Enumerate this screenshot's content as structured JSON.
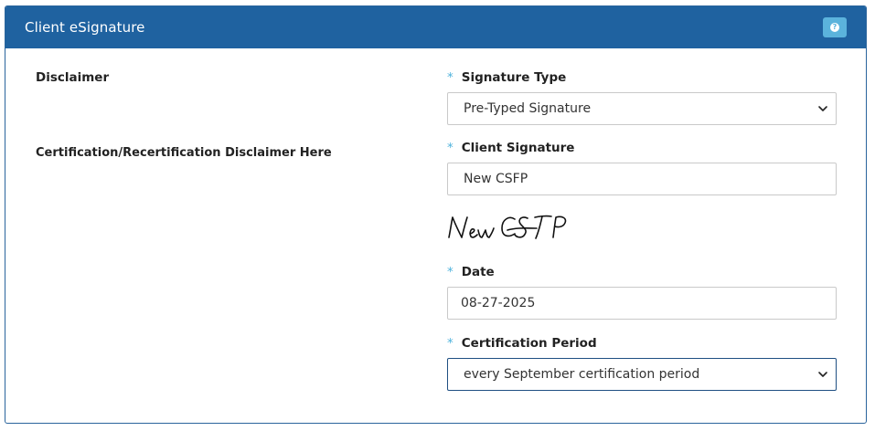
{
  "panel": {
    "title": "Client eSignature",
    "help_icon": "question-circle-icon"
  },
  "disclaimer": {
    "heading": "Disclaimer",
    "text": "Certification/Recertification Disclaimer Here"
  },
  "form": {
    "required_marker": "*",
    "signature_type": {
      "label": "Signature Type",
      "value": "Pre-Typed Signature"
    },
    "client_signature": {
      "label": "Client Signature",
      "value": "New CSFP",
      "rendered_signature": "New CSFP"
    },
    "date": {
      "label": "Date",
      "value": "08-27-2025"
    },
    "certification_period": {
      "label": "Certification Period",
      "value": "every September certification period"
    }
  },
  "colors": {
    "header_bg": "#1f62a0",
    "required_star": "#4fb3dc",
    "help_button": "#5bb3dc"
  }
}
